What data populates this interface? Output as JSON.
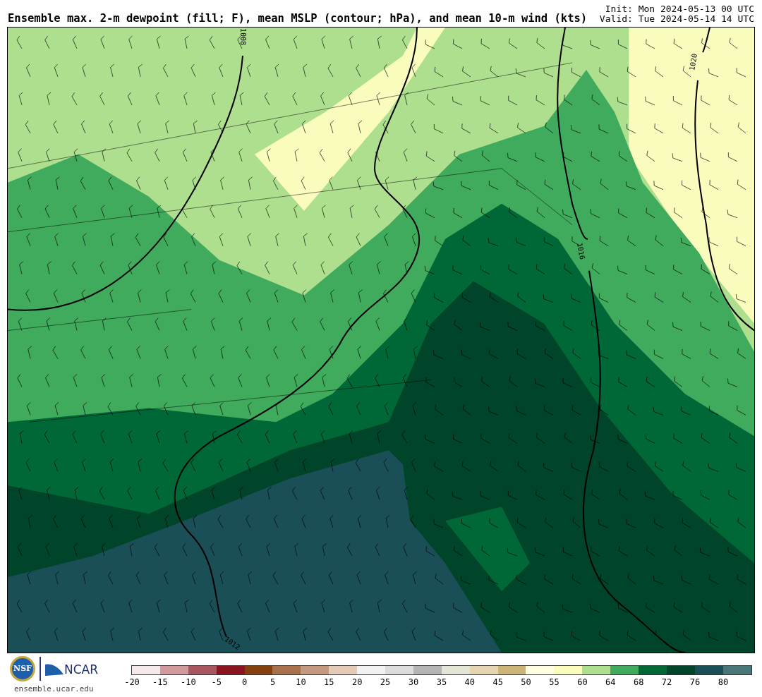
{
  "header": {
    "title": "Ensemble max. 2-m dewpoint (fill; F), mean MSLP (contour; hPa), and mean 10-m wind (kts)",
    "init": "Init: Mon 2024-05-13 00 UTC",
    "valid": "Valid: Tue 2024-05-14 14 UTC"
  },
  "map": {
    "contour_labels": [
      "1008",
      "1016",
      "1020",
      "1012"
    ]
  },
  "footer": {
    "logos": [
      "NSF",
      "NCAR"
    ],
    "site": "ensemble.ucar.edu"
  },
  "colorbar": {
    "bins": [
      {
        "color": "#f5e9e9"
      },
      {
        "color": "#d09a9e"
      },
      {
        "color": "#a85760"
      },
      {
        "color": "#8b1420"
      },
      {
        "color": "#86400f"
      },
      {
        "color": "#a8714c"
      },
      {
        "color": "#c39a80"
      },
      {
        "color": "#e3cbb8"
      },
      {
        "color": "#f2f2f2"
      },
      {
        "color": "#dcdcdc"
      },
      {
        "color": "#b4b4b4"
      },
      {
        "color": "#e3e5d6"
      },
      {
        "color": "#e5d5b0"
      },
      {
        "color": "#cdb57a"
      },
      {
        "color": "#fffee3"
      },
      {
        "color": "#f9fcbc"
      },
      {
        "color": "#addf8e"
      },
      {
        "color": "#41ab5d"
      },
      {
        "color": "#006837"
      },
      {
        "color": "#004529"
      },
      {
        "color": "#1a4f58"
      },
      {
        "color": "#4b7677"
      }
    ],
    "ticks": [
      "-20",
      "-15",
      "-10",
      "-5",
      "0",
      "5",
      "10",
      "15",
      "20",
      "25",
      "30",
      "35",
      "40",
      "45",
      "50",
      "55",
      "60",
      "64",
      "68",
      "72",
      "76",
      "80"
    ]
  }
}
